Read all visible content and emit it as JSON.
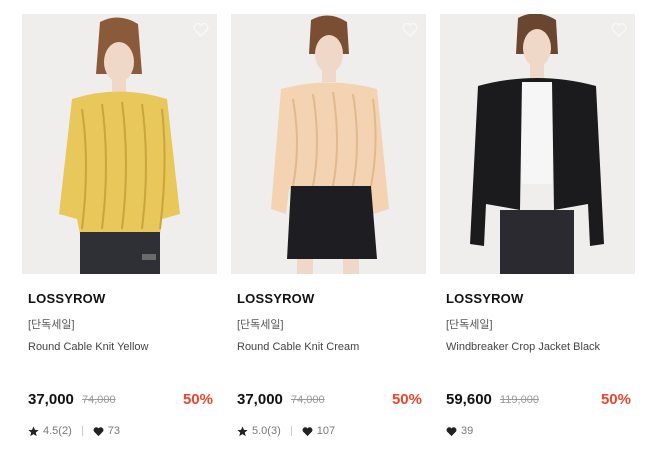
{
  "products": [
    {
      "brand": "LOSSYROW",
      "tag": "[단독세일]",
      "name": "Round Cable Knit Yellow",
      "price": "37,000",
      "original_price": "74,000",
      "discount": "50%",
      "rating": "4.5(2)",
      "likes": "73",
      "image": {
        "icon": "product-photo",
        "top_color": "#e8c85a",
        "bottom_color": "#2f2f36"
      }
    },
    {
      "brand": "LOSSYROW",
      "tag": "[단독세일]",
      "name": "Round Cable Knit Cream",
      "price": "37,000",
      "original_price": "74,000",
      "discount": "50%",
      "rating": "5.0(3)",
      "likes": "107",
      "image": {
        "icon": "product-photo",
        "top_color": "#f3d3b1",
        "bottom_color": "#1e1e22"
      }
    },
    {
      "brand": "LOSSYROW",
      "tag": "[단독세일]",
      "name": "Windbreaker Crop Jacket Black",
      "price": "59,600",
      "original_price": "119,000",
      "discount": "50%",
      "likes": "39",
      "image": {
        "icon": "product-photo",
        "top_color": "#1b1b1d",
        "bottom_color": "#2a2a30"
      }
    }
  ],
  "colors": {
    "discount": "#e8472e",
    "background": "#ffffff"
  }
}
